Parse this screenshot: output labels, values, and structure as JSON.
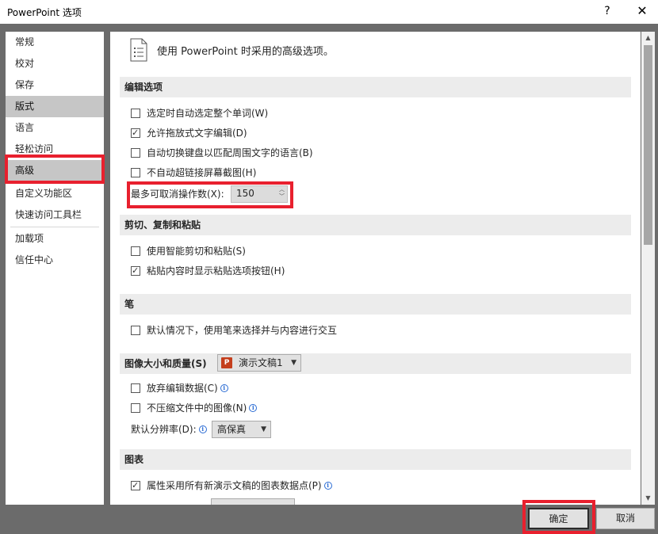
{
  "window": {
    "title": "PowerPoint 选项",
    "help_label": "?",
    "close_label": "✕"
  },
  "sidebar": {
    "items": [
      {
        "label": "常规"
      },
      {
        "label": "校对"
      },
      {
        "label": "保存"
      },
      {
        "label": "版式"
      },
      {
        "label": "语言"
      },
      {
        "label": "轻松访问"
      },
      {
        "label": "高级"
      },
      {
        "label": "自定义功能区"
      },
      {
        "label": "快速访问工具栏"
      },
      {
        "label": "加载项"
      },
      {
        "label": "信任中心"
      }
    ]
  },
  "main": {
    "header": "使用 PowerPoint 时采用的高级选项。",
    "sections": {
      "editing": {
        "title": "编辑选项",
        "options": [
          {
            "label": "选定时自动选定整个单词(W)",
            "checked": false
          },
          {
            "label": "允许拖放式文字编辑(D)",
            "checked": true
          },
          {
            "label": "自动切换键盘以匹配周围文字的语言(B)",
            "checked": false
          },
          {
            "label": "不自动超链接屏幕截图(H)",
            "checked": false
          }
        ],
        "undo_label": "最多可取消操作数(X):",
        "undo_value": "150"
      },
      "clipboard": {
        "title": "剪切、复制和粘贴",
        "options": [
          {
            "label": "使用智能剪切和粘贴(S)",
            "checked": false
          },
          {
            "label": "粘贴内容时显示粘贴选项按钮(H)",
            "checked": true
          }
        ]
      },
      "pen": {
        "title": "笔",
        "options": [
          {
            "label": "默认情况下，使用笔来选择并与内容进行交互",
            "checked": false
          }
        ]
      },
      "image": {
        "title": "图像大小和质量(S)",
        "document_select": "演示文稿1",
        "options": [
          {
            "label": "放弃编辑数据(C)",
            "checked": false
          },
          {
            "label": "不压缩文件中的图像(N)",
            "checked": false
          }
        ],
        "resolution_label": "默认分辨率(D):",
        "resolution_value": "高保真"
      },
      "chart": {
        "title": "图表",
        "options": [
          {
            "label": "属性采用所有新演示文稿的图表数据点(P)",
            "checked": true
          }
        ]
      }
    }
  },
  "buttons": {
    "ok": "确定",
    "cancel": "取消"
  },
  "colors": {
    "highlight_box": "#e8202e",
    "frame": "#6b6b6b",
    "section_bg": "#ececec",
    "selected_nav": "#c6c6c6"
  }
}
